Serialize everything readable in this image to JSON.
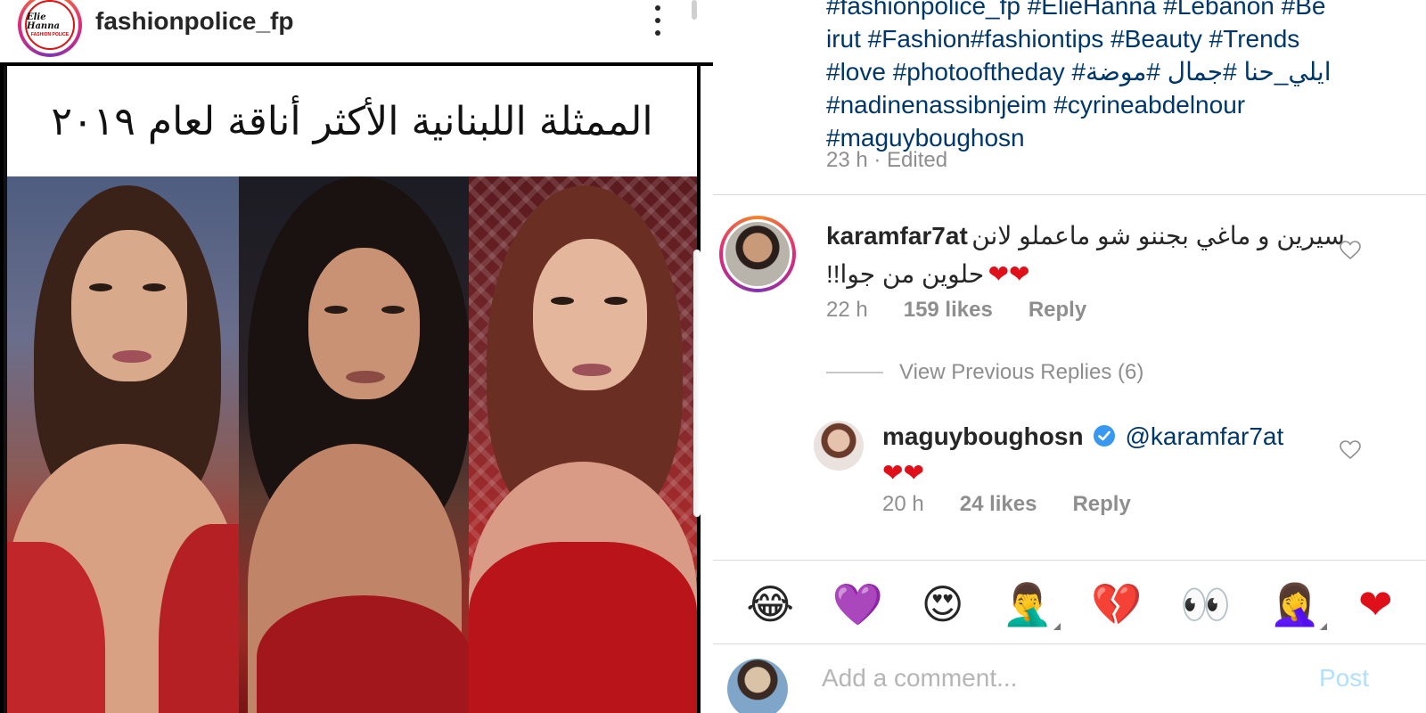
{
  "post": {
    "username": "fashionpolice_fp",
    "logo_text": "Elie Hanna",
    "logo_subtext": "FASHION POLICE",
    "image_title": "الممثلة اللبنانية الأكثر أناقة لعام ٢٠١٩"
  },
  "caption": {
    "lines": [
      "#fashionpolice_fp #ElieHanna #Lebanon #Be",
      "irut #Fashion#fashiontips #Beauty #Trends",
      " #love #photooftheday #ايلي_حنا #جمال #موضة",
      "#nadinenassibnjeim #cyrineabdelnour",
      "#maguyboughosn"
    ],
    "time": "23 h · Edited"
  },
  "comments": [
    {
      "user": "karamfar7at",
      "text": "سيرين و ماغي بجننو شو ماعملو لانن حلوين من جوا!!",
      "hearts": "❤❤",
      "time": "22 h",
      "likes": "159 likes",
      "reply": "Reply"
    }
  ],
  "view_replies": "View Previous Replies (6)",
  "reply": {
    "user": "maguyboughosn",
    "mention": "@karamfar7at",
    "hearts": "❤❤",
    "time": "20 h",
    "likes": "24 likes",
    "reply": "Reply"
  },
  "emojis": [
    "😂",
    "💜",
    "😍",
    "🤦‍♂️",
    "💔",
    "👀",
    "🤦‍♀️",
    "❤"
  ],
  "composer": {
    "placeholder": "Add a comment...",
    "post_label": "Post"
  },
  "colors": {
    "link": "#00376b",
    "meta": "#8e8e8e",
    "post_disabled": "#b2dffc",
    "verified": "#3897f0"
  }
}
